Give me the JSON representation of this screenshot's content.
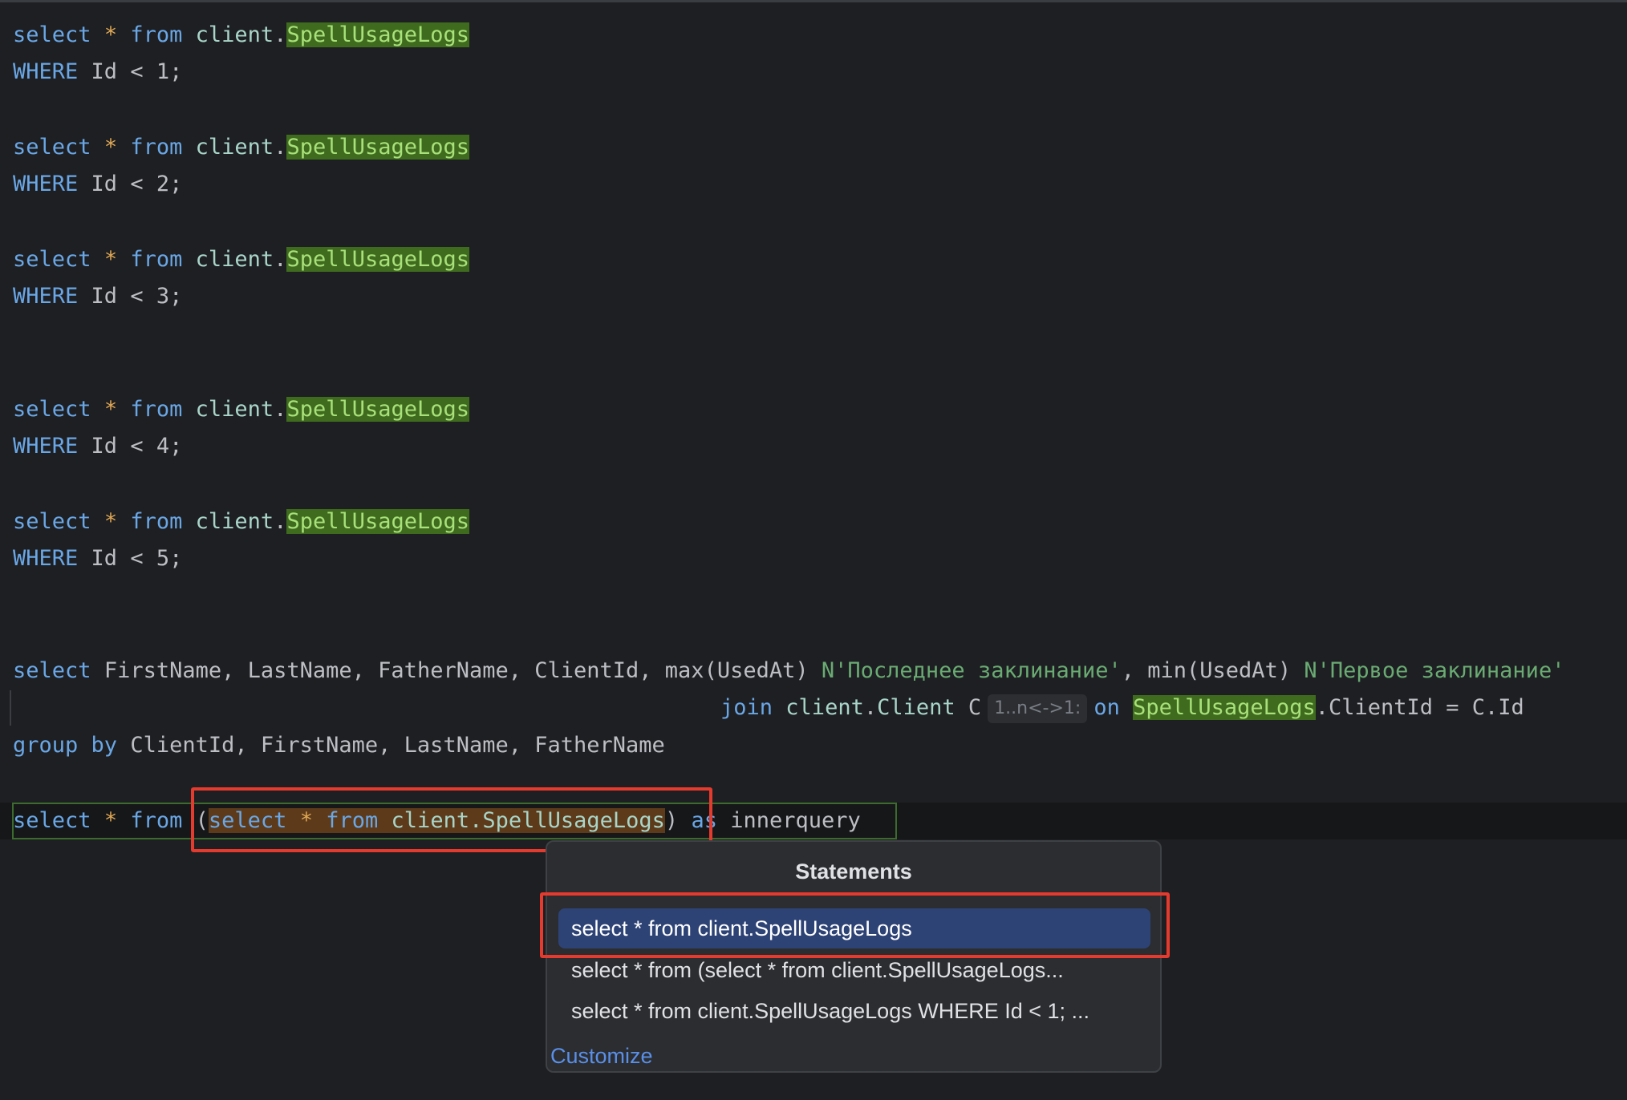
{
  "editor": {
    "queries": [
      {
        "line1": {
          "kw_select": "select",
          "star": "*",
          "kw_from": "from",
          "schema": "client",
          "dot": ".",
          "table": "SpellUsageLogs"
        },
        "line2": {
          "kw_where": "WHERE",
          "col": "Id",
          "op": "<",
          "val": "1",
          "semi": ";"
        }
      },
      {
        "line1": {
          "kw_select": "select",
          "star": "*",
          "kw_from": "from",
          "schema": "client",
          "dot": ".",
          "table": "SpellUsageLogs"
        },
        "line2": {
          "kw_where": "WHERE",
          "col": "Id",
          "op": "<",
          "val": "2",
          "semi": ";"
        }
      },
      {
        "line1": {
          "kw_select": "select",
          "star": "*",
          "kw_from": "from",
          "schema": "client",
          "dot": ".",
          "table": "SpellUsageLogs"
        },
        "line2": {
          "kw_where": "WHERE",
          "col": "Id",
          "op": "<",
          "val": "3",
          "semi": ";"
        }
      },
      {
        "line1": {
          "kw_select": "select",
          "star": "*",
          "kw_from": "from",
          "schema": "client",
          "dot": ".",
          "table": "SpellUsageLogs"
        },
        "line2": {
          "kw_where": "WHERE",
          "col": "Id",
          "op": "<",
          "val": "4",
          "semi": ";"
        }
      },
      {
        "line1": {
          "kw_select": "select",
          "star": "*",
          "kw_from": "from",
          "schema": "client",
          "dot": ".",
          "table": "SpellUsageLogs"
        },
        "line2": {
          "kw_where": "WHERE",
          "col": "Id",
          "op": "<",
          "val": "5",
          "semi": ";"
        }
      }
    ],
    "group_query": {
      "line1": {
        "kw_select": "select",
        "cols": "FirstName, LastName, FatherName, ClientId, ",
        "max_fn": "max(UsedAt) ",
        "alias1": "N'Последнее заклинание'",
        "comma": ", ",
        "min_fn": "min(UsedAt) ",
        "alias2": "N'Первое заклинание'"
      },
      "line2": {
        "kw_join": "join",
        "schema": "client",
        "dot": ".",
        "table": "Client",
        "alias": "C",
        "inlay_hint": "1..n<->1:",
        "kw_on": "on",
        "table_ref": "SpellUsageLogs",
        "rest": ".ClientId = C.Id"
      },
      "line3": {
        "kw_group_by": "group by",
        "cols": "ClientId, FirstName, LastName, FatherName"
      }
    },
    "current_line": {
      "kw_select": "select",
      "star": "*",
      "kw_from": "from",
      "paren_open": "(",
      "sub_select": "select",
      "sub_star": "*",
      "sub_from": "from",
      "sub_table": "client.SpellUsageLogs",
      "paren_close": ")",
      "kw_as": "as",
      "alias": "innerquery"
    }
  },
  "popup": {
    "title": "Statements",
    "items": [
      {
        "label": "select * from client.SpellUsageLogs",
        "selected": true
      },
      {
        "label": "select * from (select * from client.SpellUsageLogs...",
        "selected": false
      },
      {
        "label": "select * from client.SpellUsageLogs WHERE Id < 1; ...",
        "selected": false
      }
    ],
    "customize_label": "Customize"
  },
  "colors": {
    "background": "#1e1f22",
    "keyword": "#6aa7e6",
    "table_highlight_bg": "#3f6b1e",
    "selection_bg": "#5c3a1a",
    "annotation_red": "#e53a2e",
    "popup_selected_bg": "#2e4375",
    "link": "#5a8fe8"
  }
}
